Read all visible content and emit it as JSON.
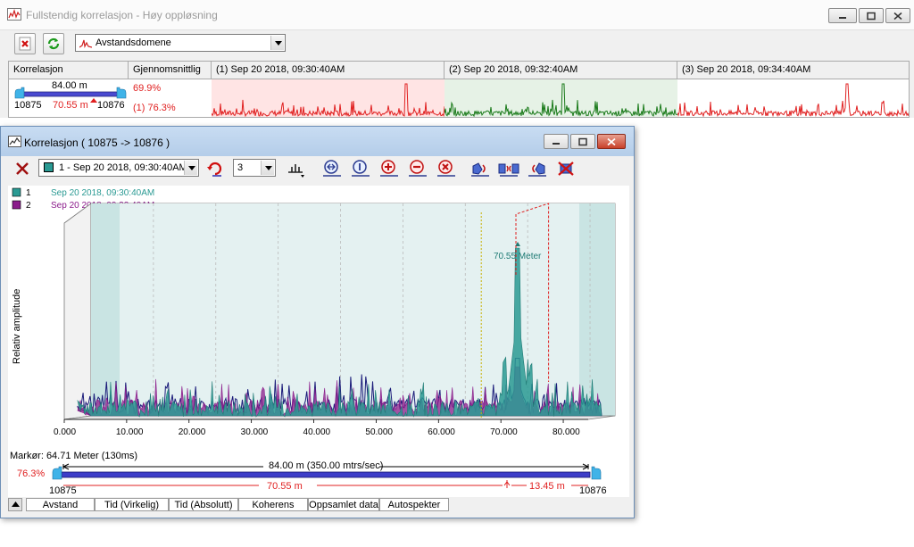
{
  "window": {
    "title": "Fullstendig korrelasjon - Høy oppløsning"
  },
  "toolbar": {
    "close_icon": "red-x-icon",
    "refresh_icon": "green-refresh-icon",
    "domain_select": "Avstandsdomene"
  },
  "summary": {
    "headers": {
      "korrelasjon": "Korrelasjon",
      "gjennomsnitt": "Gjennomsnittlig",
      "rec1": "(1) Sep 20 2018, 09:30:40AM",
      "rec2": "(2) Sep 20 2018, 09:32:40AM",
      "rec3": "(3) Sep 20 2018, 09:34:40AM"
    },
    "pipe_length": "84.00 m",
    "left_sensor": "10875",
    "right_sensor": "10876",
    "leak_distance": "70.55 m",
    "avg_value": "69.9%",
    "avg_ref": "(1) 76.3%",
    "colors": {
      "rec1": "#e02020",
      "rec2": "#1a7a1a",
      "rec3": "#e02020"
    }
  },
  "child": {
    "title": "Korrelasjon ( 10875 -> 10876 )",
    "recording_select": "1 - Sep 20 2018, 09:30:40AM",
    "count_select": "3",
    "toolbar_icons": [
      "delete-icon",
      "recording-color-icon",
      "reload-icon",
      "filter-icon",
      "zoom-out-icon",
      "zoom-reset-icon",
      "zoom-in-icon",
      "zoom-minus-icon",
      "zoom-cancel-icon",
      "sensor-left-icon",
      "sensor-both-icon",
      "sensor-right-icon",
      "sensor-off-icon"
    ]
  },
  "chart_data": {
    "type": "line",
    "xlabel": "",
    "ylabel": "Relativ amplitude",
    "x_ticks": [
      "0.000",
      "10.000",
      "20.000",
      "30.000",
      "40.000",
      "50.000",
      "60.000",
      "70.000",
      "80.000"
    ],
    "xlim": [
      0,
      84
    ],
    "series": [
      {
        "name": "Sep 20 2018, 09:30:40AM",
        "id": "1",
        "color": "#2a9a93"
      },
      {
        "name": "Sep 20 2018, 09:32:40AM",
        "id": "2",
        "color": "#8b1c8b"
      }
    ],
    "peak": {
      "x": 70.55,
      "label": "70.55 Meter"
    },
    "cursor_x": 64.71,
    "grid": true,
    "legend": "top-left"
  },
  "marker": {
    "text": "Markør: 64.71 Meter (130ms)",
    "ref_percent": "76.3%",
    "length_label": "84.00 m   (350.00 mtrs/sec)",
    "left_sensor": "10875",
    "right_sensor": "10876",
    "left_distance": "70.55 m",
    "right_distance": "13.45 m"
  },
  "tabs": [
    "Avstand",
    "Tid (Virkelig)",
    "Tid (Absolutt)",
    "Koherens",
    "Oppsamlet data",
    "Autospekter"
  ]
}
